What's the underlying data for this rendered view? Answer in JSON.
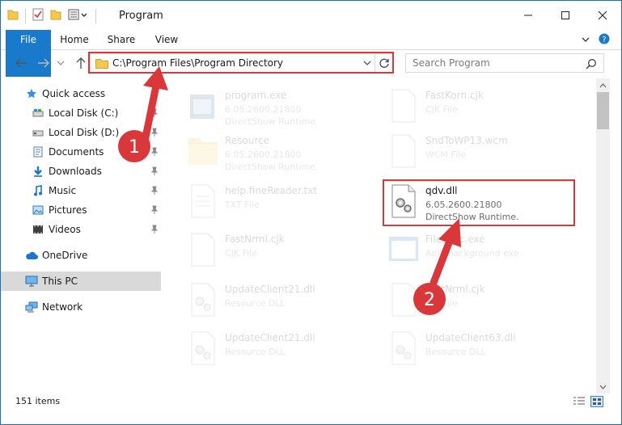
{
  "window": {
    "title": "Program",
    "accent": "#1979ca",
    "annotation_color": "#d9373a"
  },
  "ribbon": {
    "file": "File",
    "home": "Home",
    "share": "Share",
    "view": "View"
  },
  "navigation": {
    "address": "C:\\Program Files\\Program Directory",
    "search_placeholder": "Search Program"
  },
  "sidebar": {
    "items": [
      {
        "label": "Quick access",
        "icon": "star-icon"
      },
      {
        "label": "Local Disk (C:)",
        "icon": "drive-icon",
        "pinned": true
      },
      {
        "label": "Local Disk (D:)",
        "icon": "drive-icon",
        "pinned": true
      },
      {
        "label": "Documents",
        "icon": "documents-icon",
        "pinned": true
      },
      {
        "label": "Downloads",
        "icon": "download-icon",
        "pinned": true
      },
      {
        "label": "Music",
        "icon": "music-icon",
        "pinned": true
      },
      {
        "label": "Pictures",
        "icon": "pictures-icon",
        "pinned": true
      },
      {
        "label": "Videos",
        "icon": "videos-icon",
        "pinned": true
      },
      {
        "label": "OneDrive",
        "icon": "cloud-icon"
      },
      {
        "label": "This PC",
        "icon": "computer-icon",
        "selected": true
      },
      {
        "label": "Network",
        "icon": "network-icon"
      }
    ]
  },
  "files": [
    {
      "name": "program.exe",
      "line1": "6.05.2600.21800",
      "line2": "DirectShow Runtime",
      "icon": "exe-icon"
    },
    {
      "name": "FastKorn.cjk",
      "line1": "CJK File",
      "line2": "",
      "icon": "blank-file-icon"
    },
    {
      "name": "Resource",
      "line1": "6.05.2600.21800",
      "line2": "DirectShow Runtime",
      "icon": "folder-icon"
    },
    {
      "name": "SndToWP13.wcm",
      "line1": "WCM File",
      "line2": "",
      "icon": "blank-file-icon"
    },
    {
      "name": "help.fineReader.txt",
      "line1": "TXT File",
      "line2": "",
      "icon": "text-file-icon"
    },
    {
      "name": "qdv.dll",
      "line1": "6.05.2600.21800",
      "line2": "DirectShow Runtime.",
      "icon": "dll-gear-icon"
    },
    {
      "name": "FastNrml.cjk",
      "line1": "CJK File",
      "line2": "",
      "icon": "blank-file-icon"
    },
    {
      "name": "FileExec.exe",
      "line1": "AdIP background exe",
      "line2": "",
      "icon": "app-window-icon"
    },
    {
      "name": "UpdateClient21.dll",
      "line1": "Resource DLL",
      "line2": "",
      "icon": "dll-gear-icon"
    },
    {
      "name": "FastNrml.cjk",
      "line1": "CJK File",
      "line2": "",
      "icon": "blank-file-icon"
    },
    {
      "name": "UpdateClient21.dll",
      "line1": "Resource DLL",
      "line2": "",
      "icon": "dll-gear-icon"
    },
    {
      "name": "UpdateClient63.dll",
      "line1": "Resource DLL",
      "line2": "",
      "icon": "dll-gear-icon"
    }
  ],
  "status": {
    "count": "151 items"
  },
  "annotations": {
    "step1": "1",
    "step2": "2"
  }
}
